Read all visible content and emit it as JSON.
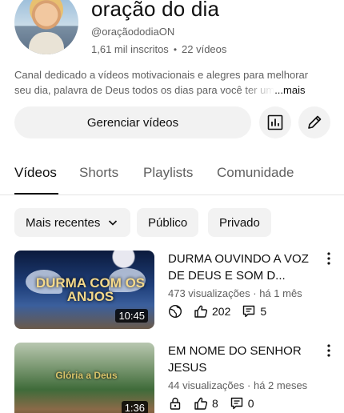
{
  "channel": {
    "title": "oração do dia",
    "handle": "@oraçãododiaON",
    "subscribers": "1,61 mil inscritos",
    "separator": "•",
    "videos_count": "22 vídeos",
    "description_line1": "Canal dedicado a vídeos motivacionais e alegres para melhorar",
    "description_line2": "seu dia, palavra de Deus todos os dias para você ter um",
    "more_label": "...mais"
  },
  "actions": {
    "manage_label": "Gerenciar vídeos",
    "stats_icon": "analytics-icon",
    "edit_icon": "pencil-icon"
  },
  "tabs": [
    {
      "label": "Vídeos",
      "active": true
    },
    {
      "label": "Shorts",
      "active": false
    },
    {
      "label": "Playlists",
      "active": false
    },
    {
      "label": "Comunidade",
      "active": false
    }
  ],
  "filters": {
    "sort_label": "Mais recentes",
    "chip_public": "Público",
    "chip_private": "Privado"
  },
  "videos": [
    {
      "title": "DURMA OUVINDO A VOZ DE DEUS E SOM D...",
      "thumbnail_text": "DURMA COM OS ANJOS",
      "duration": "10:45",
      "views": "473 visualizações",
      "age": "há 1 mês",
      "visibility_icon": "globe-icon",
      "likes": "202",
      "comments": "5"
    },
    {
      "title": "EM NOME DO SENHOR JESUS",
      "thumbnail_text": "Glória a Deus",
      "duration": "1:36",
      "views": "44 visualizações",
      "age": "há 2 meses",
      "visibility_icon": "lock-icon",
      "likes": "8",
      "comments": "0"
    }
  ],
  "colors": {
    "text_primary": "#0f0f0f",
    "text_secondary": "#606060",
    "chip_bg": "#f2f2f2"
  }
}
